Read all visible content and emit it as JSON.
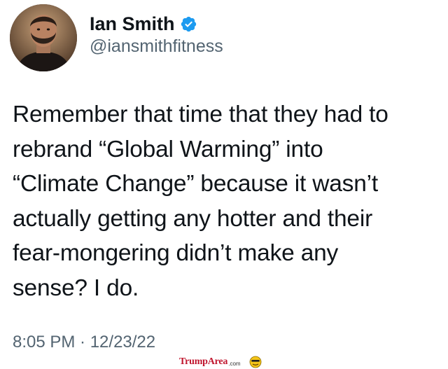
{
  "tweet": {
    "author": {
      "display_name": "Ian Smith",
      "handle": "@iansmithfitness",
      "verified": true
    },
    "text": "Remember that time that they had to\nrebrand “Global Warming” into\n“Climate Change” because it wasn’t\nactually getting any hotter and their\nfear-mongering didn’t make any\nsense? I do.",
    "timestamp": "8:05 PM · 12/23/22"
  },
  "watermark": {
    "brand_trump": "Trump",
    "brand_area": "Area",
    "brand_com": ".com"
  },
  "colors": {
    "verified_badge": "#1d9bf0",
    "secondary_text": "#536471",
    "primary_text": "#0f1419",
    "watermark_red": "#c0162e"
  },
  "icons": {
    "verified": "verified-badge-icon",
    "avatar": "profile-photo",
    "watermark_face": "smiley-face-icon"
  }
}
